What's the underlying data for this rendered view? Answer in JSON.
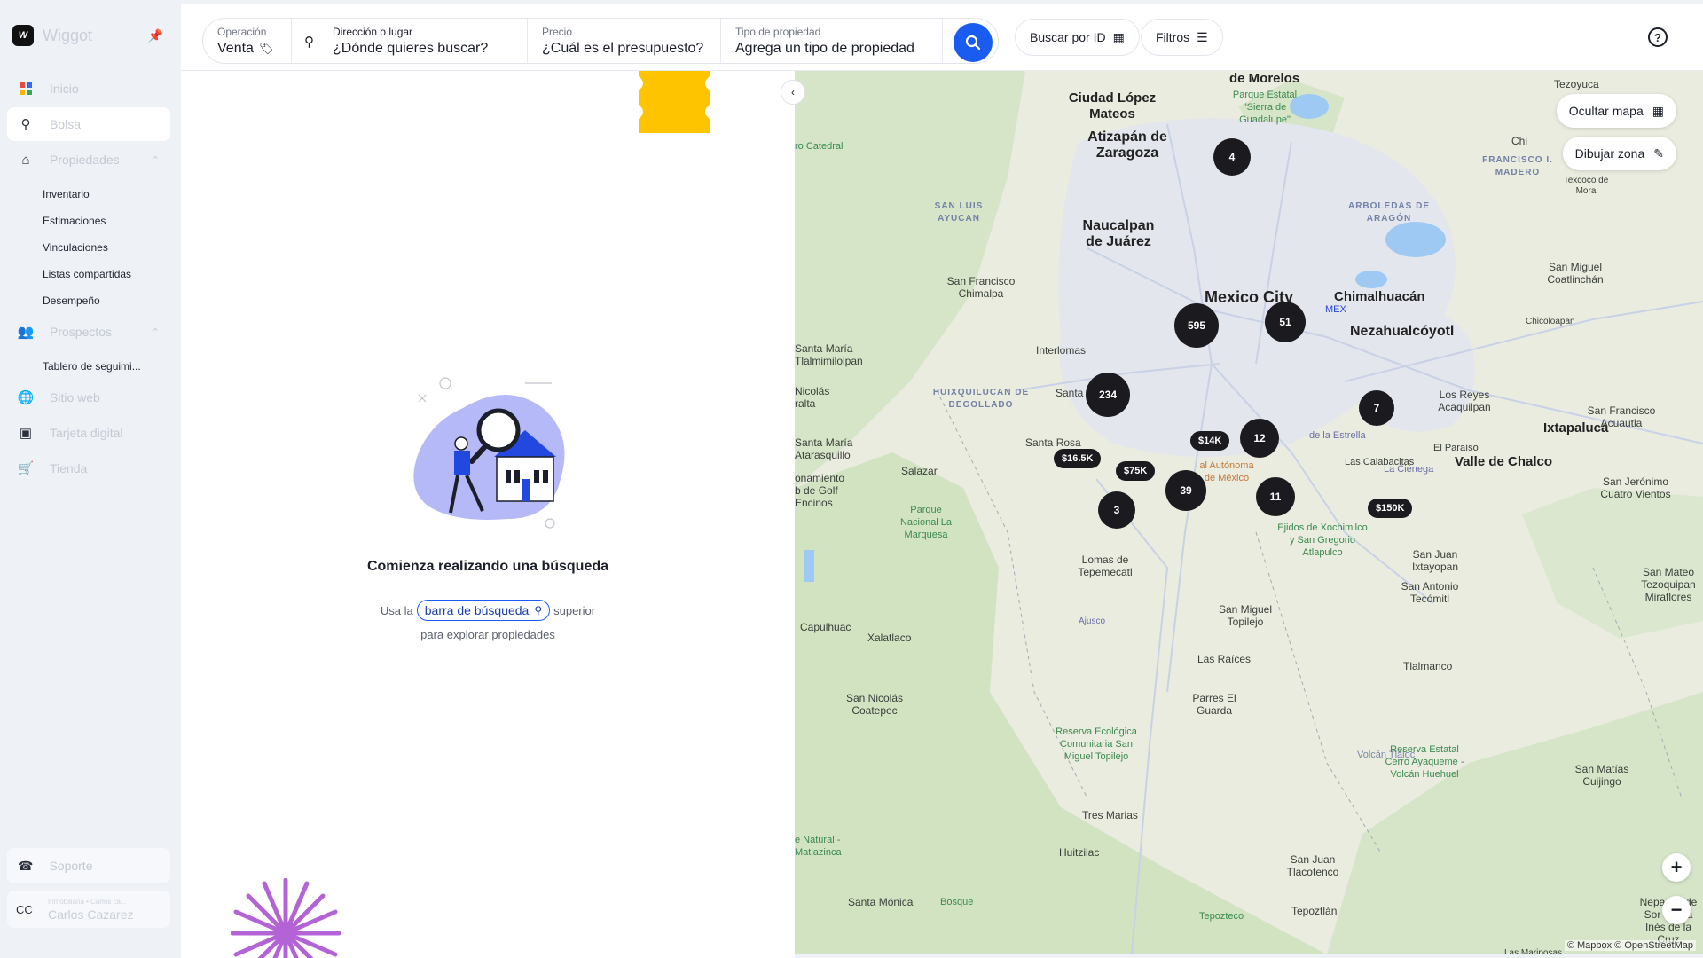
{
  "app": {
    "name": "Wiggot",
    "logo": "W"
  },
  "sidebar": {
    "items": [
      {
        "label": "Inicio",
        "icon": "apps-icon"
      },
      {
        "label": "Bolsa",
        "icon": "search-icon"
      },
      {
        "label": "Propiedades",
        "icon": "home-icon"
      },
      {
        "label": "Prospectos",
        "icon": "people-icon"
      },
      {
        "label": "Sitio web",
        "icon": "globe-icon"
      },
      {
        "label": "Tarjeta digital",
        "icon": "card-icon"
      },
      {
        "label": "Tienda",
        "icon": "cart-icon"
      }
    ],
    "properties_sub": [
      "Inventario",
      "Estimaciones",
      "Vinculaciones",
      "Listas compartidas",
      "Desempeño"
    ],
    "prospects_sub": [
      "Tablero de seguimi..."
    ],
    "support": "Soporte",
    "user": {
      "initials": "CC",
      "name": "Carlos Cazarez",
      "meta": "Inmobiliaria • Carlos ca..."
    }
  },
  "search": {
    "operation_label": "Operación",
    "operation_value": "Venta",
    "address_label": "Dirección o lugar",
    "address_placeholder": "¿Dónde quieres buscar?",
    "price_label": "Precio",
    "price_placeholder": "¿Cuál es el presupuesto?",
    "type_label": "Tipo de propiedad",
    "type_placeholder": "Agrega un tipo de propiedad",
    "search_by_id": "Buscar por ID",
    "filters": "Filtros"
  },
  "empty_state": {
    "title": "Comienza realizando una búsqueda",
    "prefix": "Usa la",
    "link": "barra de búsqueda",
    "suffix": "superior",
    "line2": "para explorar propiedades"
  },
  "map": {
    "hide_map": "Ocultar mapa",
    "draw_zone": "Dibujar zona",
    "attribution": "© Mapbox © OpenStreetMap",
    "clusters": [
      "4",
      "595",
      "51",
      "234",
      "7",
      "12",
      "39",
      "11",
      "3"
    ],
    "prices": [
      "$14K",
      "$16.5K",
      "$75K",
      "$150K"
    ],
    "places": {
      "mexico_city": "Mexico City",
      "nezahualcoyotl": "Nezahualcóyotl",
      "chimalhuacan": "Chimalhuacán",
      "valle_chalco": "Valle de Chalco",
      "ixtapaluca": "Ixtapaluca",
      "naucalpan": "Naucalpan de Juárez",
      "atizapan": "Atizapán de Zaragoza",
      "ciudad_lopez": "Ciudad López Mateos",
      "morelos": "de Morelos",
      "san_francisco_chimalpa": "San Francisco Chimalpa",
      "interlomas": "Interlomas",
      "santa_rosa": "Santa Rosa",
      "salazar": "Salazar",
      "huixquilucan": "HUIXQUILUCAN DE DEGOLLADO",
      "san_luis": "SAN LUIS AYUCAN",
      "arboledas": "ARBOLEDAS DE ARAGÓN",
      "fco_madero": "FRANCISCO I. MADERO",
      "lomas_tepemecatl": "Lomas de Tepemecatl",
      "san_miguel_topilejo": "San Miguel Topilejo",
      "las_raices": "Las Raíces",
      "parres": "Parres El Guarda",
      "tres_marias": "Tres Marias",
      "huitzilac": "Huitzilac",
      "santa_monica": "Santa Mónica",
      "san_juan_tlacotenco": "San Juan Tlacotenco",
      "tepoztlan": "Tepoztlán",
      "capulhuac": "Capulhuac",
      "xalatlaco": "Xalatlaco",
      "san_nicolas": "San Nicolás Coatepec",
      "tlalmanco": "Tlalmanco",
      "san_juan_ixtayopan": "San Juan Ixtayopan",
      "san_antonio": "San Antonio Tecómitl",
      "los_reyes": "Los Reyes Acaquilpan",
      "san_miguel_coatlinchan": "San Miguel Coatlinchán",
      "chicoloapan": "Chicoloapan",
      "san_francisco_acuautla": "San Francisco Acuautla",
      "el_paraiso": "El Paraíso",
      "las_calabacitas": "Las Calabacitas",
      "san_jeronimo": "San Jerónimo Cuatro Vientos",
      "san_mateo": "San Mateo Tezoquipan Miraflores",
      "san_matias": "San Matías Cuijingo",
      "tezoyuca": "Tezoyuca",
      "texcoco": "Texcoco de Mora",
      "santa_maria_atarasquillo": "Santa María Atarasquillo",
      "santa_maria_tlalmimilolpan": "Santa María Tlalmimilolpan",
      "ajusco": "Ajusco",
      "mex": "MEX",
      "santa": "Santa",
      "la_cienega": "La Ciénega",
      "nepantla": "Nepantla de Sor Juana Inés de la Cruz",
      "las_mariposas": "Las Mariposas",
      "pkg_sierra": "Parque Estatal \"Sierra de Guadalupe\"",
      "pkg_marquesa": "Parque Nacional La Marquesa",
      "pkg_ecologica": "Reserva Ecológica Comunitaria San Miguel Topilejo",
      "pkg_ayaqueme": "Reserva Estatal Cerro Ayaqueme - Volcán Huehuel",
      "pkg_xochimilco": "Ejidos de Xochimilco y San Gregorio Atlapulco",
      "pkg_bosque": "Bosque",
      "pkg_tepozteco": "Tepozteco",
      "pkg_catedral": "ro Catedral",
      "pkg_matlazinca": "e Natural - Matlazinca",
      "unam": "al Autónoma de México",
      "nicolas": "Nicolás ralta",
      "onamiento": "onamiento b de Golf Encinos",
      "volcan_tlaloc": "Volcán Tláloc",
      "estrella": "de la Estrella",
      "chi": "Chi"
    }
  },
  "colors": {
    "accent": "#1a5cf0",
    "cluster": "#1b1b1f",
    "blob_yellow": "#ffc400",
    "starburst": "#b463d6",
    "illus_purple": "#b6b9f7",
    "illus_blue": "#2348e0"
  }
}
